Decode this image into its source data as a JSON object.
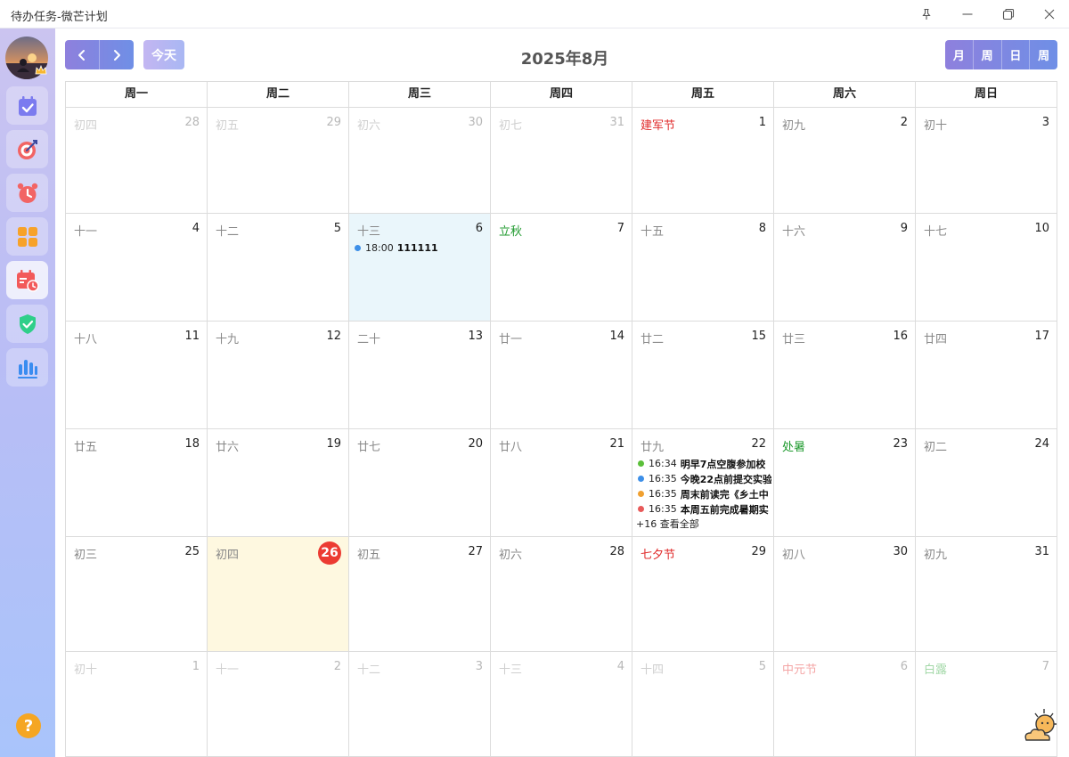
{
  "window": {
    "title": "待办任务-微芒计划"
  },
  "sidebar": {
    "items": [
      {
        "name": "todo",
        "icon": "calendar-check-icon",
        "active": false
      },
      {
        "name": "goal",
        "icon": "target-icon",
        "active": false
      },
      {
        "name": "alarm",
        "icon": "alarm-clock-icon",
        "active": false
      },
      {
        "name": "quadrant",
        "icon": "four-grid-icon",
        "active": false
      },
      {
        "name": "calendar",
        "icon": "calendar-clock-icon",
        "active": true
      },
      {
        "name": "habit",
        "icon": "shield-check-icon",
        "active": false
      },
      {
        "name": "stats",
        "icon": "bar-chart-icon",
        "active": false
      }
    ],
    "help_label": "?"
  },
  "toolbar": {
    "today_label": "今天",
    "month_title": "2025年8月",
    "views": [
      "月",
      "周",
      "日",
      "周"
    ]
  },
  "calendar": {
    "weekdays": [
      "周一",
      "周二",
      "周三",
      "周四",
      "周五",
      "周六",
      "周日"
    ],
    "weeks": [
      [
        {
          "day": "28",
          "lunar": "初四",
          "other": true
        },
        {
          "day": "29",
          "lunar": "初五",
          "other": true
        },
        {
          "day": "30",
          "lunar": "初六",
          "other": true
        },
        {
          "day": "31",
          "lunar": "初七",
          "other": true
        },
        {
          "day": "1",
          "lunar": "建军节",
          "kind": "festival"
        },
        {
          "day": "2",
          "lunar": "初九"
        },
        {
          "day": "3",
          "lunar": "初十"
        }
      ],
      [
        {
          "day": "4",
          "lunar": "十一"
        },
        {
          "day": "5",
          "lunar": "十二"
        },
        {
          "day": "6",
          "lunar": "十三",
          "selected": true,
          "events": [
            {
              "time": "18:00",
              "title": "111111",
              "color": "#3d8fe8"
            }
          ]
        },
        {
          "day": "7",
          "lunar": "立秋",
          "kind": "term"
        },
        {
          "day": "8",
          "lunar": "十五"
        },
        {
          "day": "9",
          "lunar": "十六"
        },
        {
          "day": "10",
          "lunar": "十七"
        }
      ],
      [
        {
          "day": "11",
          "lunar": "十八"
        },
        {
          "day": "12",
          "lunar": "十九"
        },
        {
          "day": "13",
          "lunar": "二十"
        },
        {
          "day": "14",
          "lunar": "廿一"
        },
        {
          "day": "15",
          "lunar": "廿二"
        },
        {
          "day": "16",
          "lunar": "廿三"
        },
        {
          "day": "17",
          "lunar": "廿四"
        }
      ],
      [
        {
          "day": "18",
          "lunar": "廿五"
        },
        {
          "day": "19",
          "lunar": "廿六"
        },
        {
          "day": "20",
          "lunar": "廿七"
        },
        {
          "day": "21",
          "lunar": "廿八"
        },
        {
          "day": "22",
          "lunar": "廿九",
          "events": [
            {
              "time": "16:34",
              "title": "明早7点空腹参加校",
              "color": "#5bbf3a"
            },
            {
              "time": "16:35",
              "title": "今晚22点前提交实验",
              "color": "#3d8fe8"
            },
            {
              "time": "16:35",
              "title": "周末前读完《乡土中",
              "color": "#f0a030"
            },
            {
              "time": "16:35",
              "title": "本周五前完成暑期实",
              "color": "#e85a5a"
            }
          ],
          "more": "+16 查看全部"
        },
        {
          "day": "23",
          "lunar": "处暑",
          "kind": "term"
        },
        {
          "day": "24",
          "lunar": "初二"
        }
      ],
      [
        {
          "day": "25",
          "lunar": "初三"
        },
        {
          "day": "26",
          "lunar": "初四",
          "today": true
        },
        {
          "day": "27",
          "lunar": "初五"
        },
        {
          "day": "28",
          "lunar": "初六"
        },
        {
          "day": "29",
          "lunar": "七夕节",
          "kind": "festival"
        },
        {
          "day": "30",
          "lunar": "初八"
        },
        {
          "day": "31",
          "lunar": "初九"
        }
      ],
      [
        {
          "day": "1",
          "lunar": "初十",
          "other": true
        },
        {
          "day": "2",
          "lunar": "十一",
          "other": true
        },
        {
          "day": "3",
          "lunar": "十二",
          "other": true
        },
        {
          "day": "4",
          "lunar": "十三",
          "other": true
        },
        {
          "day": "5",
          "lunar": "十四",
          "other": true
        },
        {
          "day": "6",
          "lunar": "中元节",
          "kind": "festival",
          "other": true
        },
        {
          "day": "7",
          "lunar": "白露",
          "kind": "term",
          "other": true
        }
      ]
    ]
  }
}
